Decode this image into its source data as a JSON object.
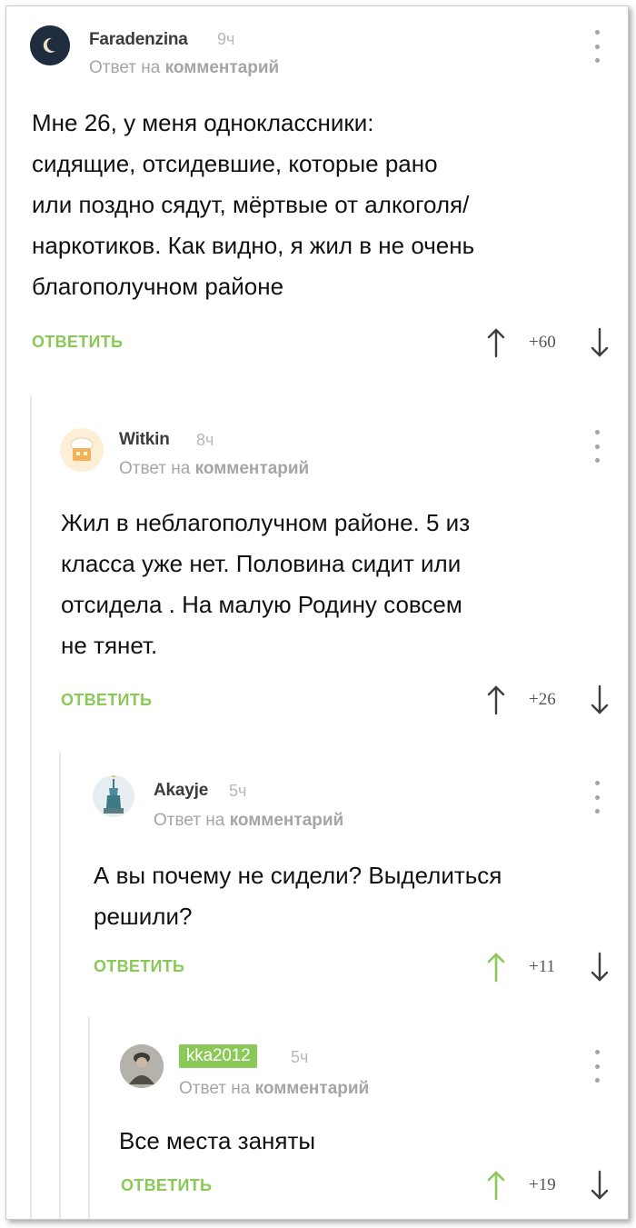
{
  "colors": {
    "accent": "#8ac858",
    "muted": "#a5a5a5",
    "text": "#111111"
  },
  "comments": [
    {
      "username": "Faradenzina",
      "time": "9ч",
      "reply_prefix": "Ответ на",
      "reply_target": "комментарий",
      "body": "Мне 26, у меня одноклассники:\nсидящие, отсидевшие, которые рано\nили поздно сядут, мёртвые от алкоголя/\nнаркотиков. Как видно, я жил в не очень\nблагополучном районе",
      "reply_label": "ОТВЕТИТЬ",
      "score": "+60",
      "upvoted": false,
      "avatar_icon": "moon-avatar"
    },
    {
      "username": "Witkin",
      "time": "8ч",
      "reply_prefix": "Ответ на",
      "reply_target": "комментарий",
      "body": "Жил в неблагополучном районе. 5 из\nкласса уже нет. Половина сидит или\nотсидела . На малую Родину совсем\nне тянет.",
      "reply_label": "ОТВЕТИТЬ",
      "score": "+26",
      "upvoted": false,
      "avatar_icon": "chef-hat-avatar"
    },
    {
      "username": "Akayje",
      "time": "5ч",
      "reply_prefix": "Ответ на",
      "reply_target": "комментарий",
      "body": "А вы почему не сидели? Выделиться\nрешили?",
      "reply_label": "ОТВЕТИТЬ",
      "score": "+11",
      "upvoted": true,
      "avatar_icon": "statue-of-liberty-avatar"
    },
    {
      "username": "kka2012",
      "time": "5ч",
      "reply_prefix": "Ответ на",
      "reply_target": "комментарий",
      "body": "Все места заняты",
      "reply_label": "ОТВЕТИТЬ",
      "score": "+19",
      "upvoted": true,
      "avatar_icon": "soldier-photo-avatar"
    }
  ]
}
